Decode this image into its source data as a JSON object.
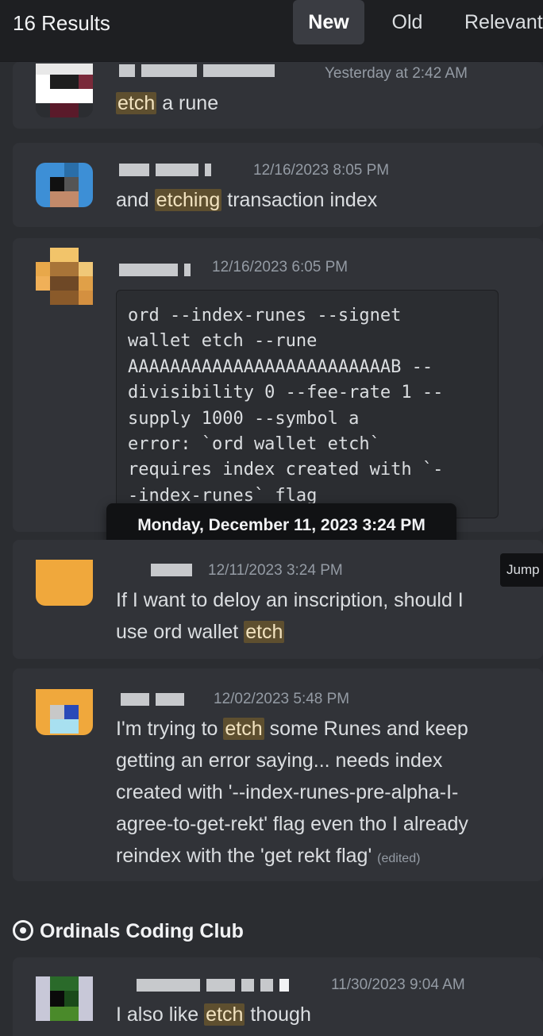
{
  "header": {
    "results": "16 Results",
    "tabs": [
      {
        "label": "New",
        "active": true
      },
      {
        "label": "Old",
        "active": false
      },
      {
        "label": "Relevant",
        "active": false
      }
    ]
  },
  "messages": [
    {
      "timestamp": "Yesterday at 2:42 AM",
      "text_before": "",
      "highlight": "etch",
      "text_after": " a rune"
    },
    {
      "timestamp": "12/16/2023 8:05 PM",
      "text_before": "and ",
      "highlight": "etching",
      "text_after": " transaction index"
    },
    {
      "timestamp": "12/16/2023 6:05 PM",
      "code": "ord --index-runes --signet\nwallet etch --rune\nAAAAAAAAAAAAAAAAAAAAAAAAAB --\ndivisibility 0 --fee-rate 1 --\nsupply 1000 --symbol a\nerror: `ord wallet etch`\nrequires index created with `-\n-index-runes` flag"
    },
    {
      "timestamp": "12/11/2023 3:24 PM",
      "line1": "If I want to deloy an inscription, should I",
      "text_before": "use ord wallet ",
      "highlight": "etch",
      "text_after": ""
    },
    {
      "timestamp": "12/02/2023 5:48 PM",
      "text_before": "I'm trying to ",
      "highlight": "etch",
      "text_after": " some Runes and keep",
      "line2": "getting an error saying... needs index",
      "line3": "created with '--index-runes-pre-alpha-I-",
      "line4": "agree-to-get-rekt' flag even tho I already",
      "line5": "reindex with the 'get rekt flag'",
      "edited": "(edited)"
    },
    {
      "timestamp": "11/30/2023 9:04 AM",
      "text_before": "I also like ",
      "highlight": "etch",
      "text_after": " though"
    }
  ],
  "tooltip": "Monday, December 11, 2023 3:24 PM",
  "jump_label": "Jump",
  "channel": {
    "name": "Ordinals Coding Club",
    "icon": "forum-icon"
  },
  "colors": {
    "highlight": "#5e4f2f",
    "background": "#2b2d31",
    "card": "#313338"
  }
}
